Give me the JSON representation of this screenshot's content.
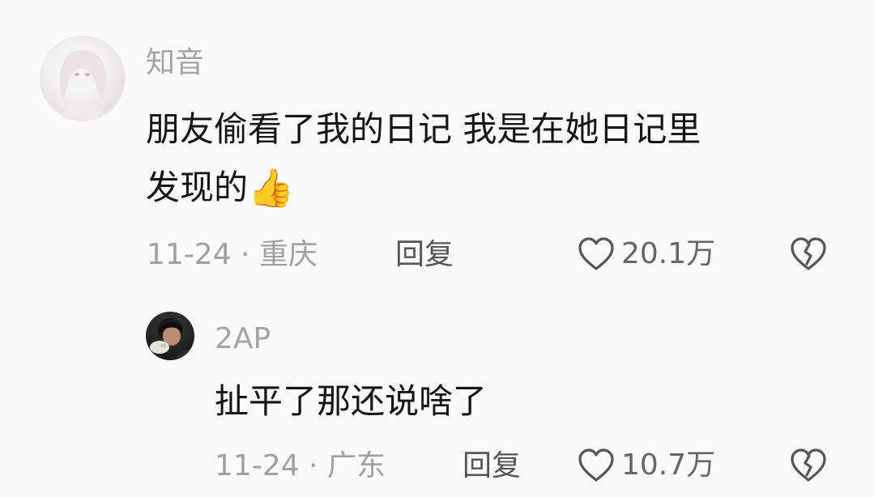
{
  "comments": [
    {
      "username": "知音",
      "text_line1": "朋友偷看了我的日记 我是在她日记里",
      "text_line2": "发现的",
      "emoji": "👍",
      "meta": "11-24 · 重庆",
      "reply_label": "回复",
      "likes": "20.1万"
    },
    {
      "username": "2AP",
      "text": "扯平了那还说啥了",
      "meta": "11-24 · 广东",
      "reply_label": "回复",
      "likes": "10.7万"
    }
  ],
  "icons": {
    "like": "heart-outline-icon",
    "dislike": "broken-heart-icon"
  }
}
